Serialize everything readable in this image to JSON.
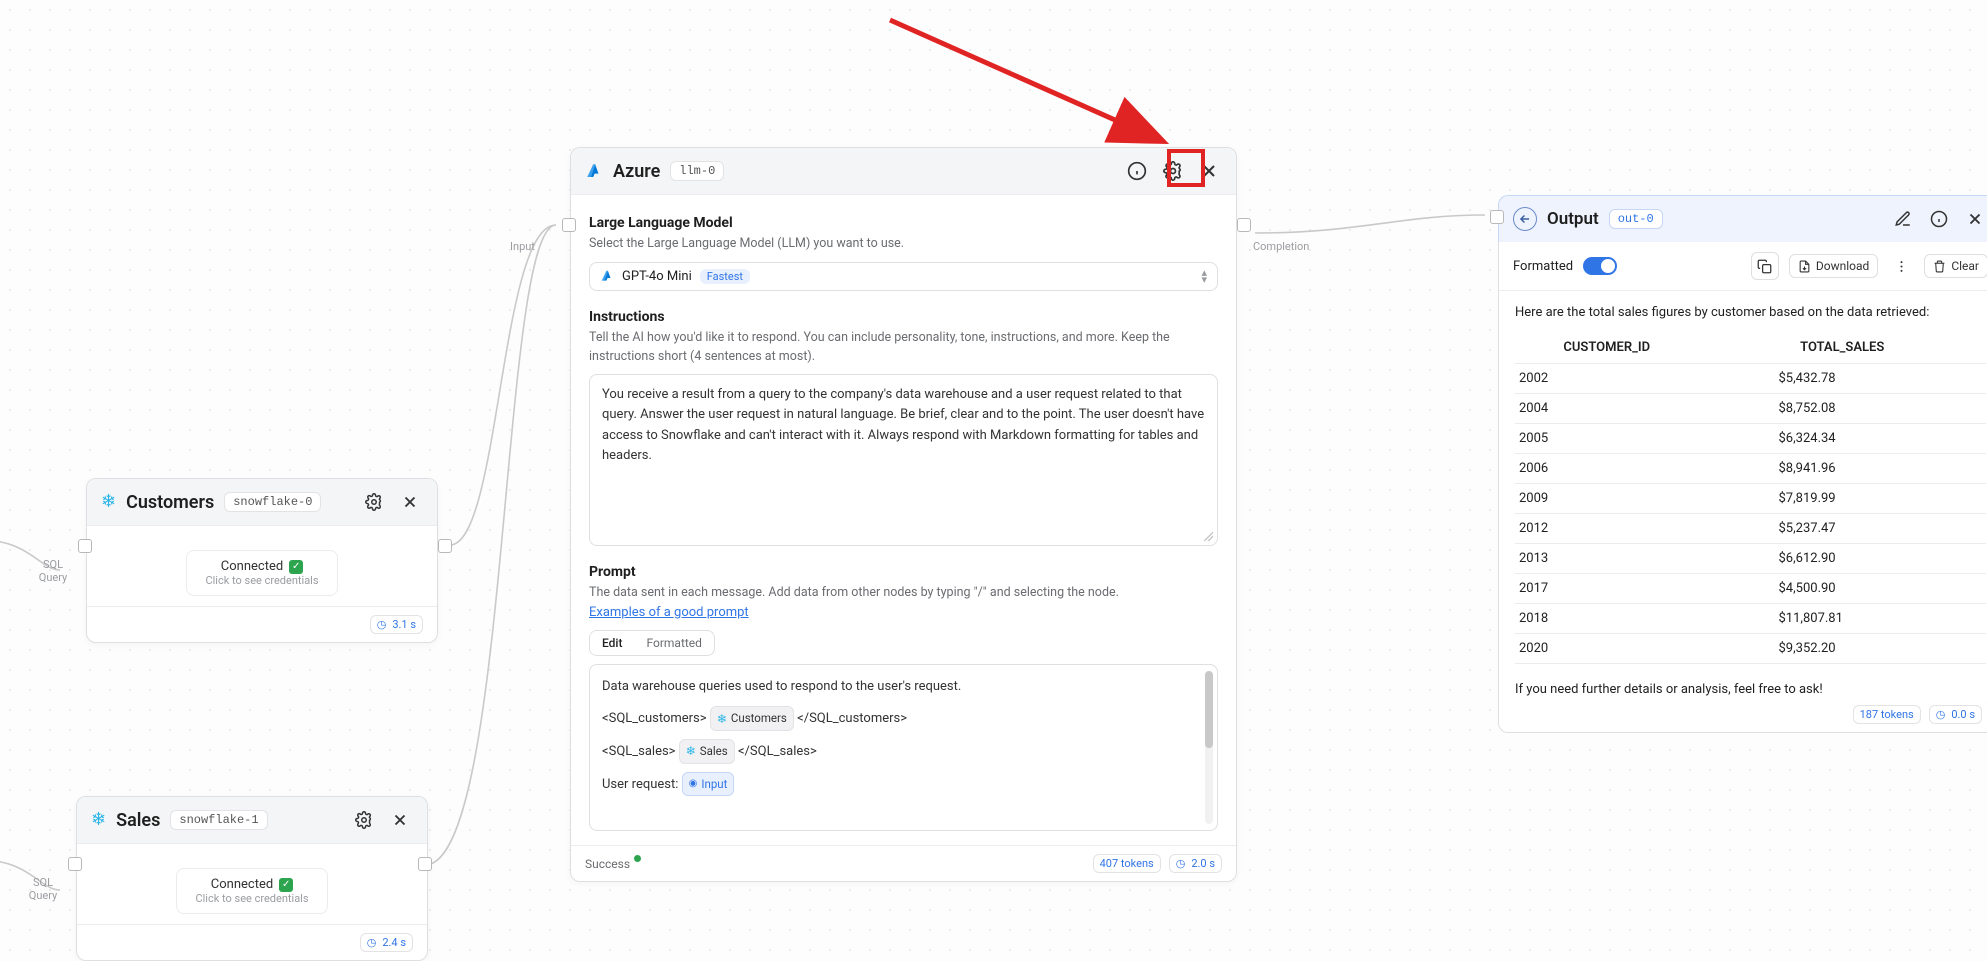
{
  "customers": {
    "title": "Customers",
    "id": "snowflake-0",
    "status": "Connected",
    "credentials_hint": "Click to see credentials",
    "elapsed": "3.1 s",
    "in_label": "SQL Query"
  },
  "sales": {
    "title": "Sales",
    "id": "snowflake-1",
    "status": "Connected",
    "credentials_hint": "Click to see credentials",
    "elapsed": "2.4 s",
    "in_label": "SQL Query"
  },
  "azure": {
    "title": "Azure",
    "id": "llm-0",
    "in_label": "Input",
    "out_label": "Completion",
    "llm_section_title": "Large Language Model",
    "llm_section_sub": "Select the Large Language Model (LLM) you want to use.",
    "model": "GPT-4o Mini",
    "model_tag": "Fastest",
    "instr_title": "Instructions",
    "instr_sub": "Tell the AI how you'd like it to respond. You can include personality, tone, instructions, and more. Keep the instructions short (4 sentences at most).",
    "instr_text": "You receive a result from a query to the company's data warehouse and a user request related to that query. Answer the user request in natural language. Be brief, clear and to the point. The user doesn't have access to Snowflake and can't interact with it. Always respond with Markdown formatting for tables and headers.",
    "prompt_title": "Prompt",
    "prompt_sub": "The data sent in each message. Add data from other nodes by typing \"/\" and selecting the node.",
    "prompt_link": "Examples of a good prompt",
    "tab_edit": "Edit",
    "tab_formatted": "Formatted",
    "prompt_line1": "Data warehouse queries used to respond to the user's request.",
    "prompt_sql_customers_open": "<SQL_customers>",
    "prompt_sql_customers_close": "</SQL_customers>",
    "prompt_chip_customers": "Customers",
    "prompt_sql_sales_open": "<SQL_sales>",
    "prompt_sql_sales_close": "</SQL_sales>",
    "prompt_chip_sales": "Sales",
    "prompt_user_request": "User request:",
    "prompt_chip_input": "Input",
    "status": "Success",
    "tokens": "407 tokens",
    "elapsed": "2.0 s"
  },
  "output": {
    "title": "Output",
    "id": "out-0",
    "formatted_label": "Formatted",
    "download_label": "Download",
    "clear_label": "Clear",
    "intro": "Here are the total sales figures by customer based on the data retrieved:",
    "col_customer": "CUSTOMER_ID",
    "col_total": "TOTAL_SALES",
    "rows": [
      {
        "id": "2002",
        "total": "$5,432.78"
      },
      {
        "id": "2004",
        "total": "$8,752.08"
      },
      {
        "id": "2005",
        "total": "$6,324.34"
      },
      {
        "id": "2006",
        "total": "$8,941.96"
      },
      {
        "id": "2009",
        "total": "$7,819.99"
      },
      {
        "id": "2012",
        "total": "$5,237.47"
      },
      {
        "id": "2013",
        "total": "$6,612.90"
      },
      {
        "id": "2017",
        "total": "$4,500.90"
      },
      {
        "id": "2018",
        "total": "$11,807.81"
      },
      {
        "id": "2020",
        "total": "$9,352.20"
      }
    ],
    "outro": "If you need further details or analysis, feel free to ask!",
    "tokens": "187 tokens",
    "elapsed": "0.0 s"
  }
}
